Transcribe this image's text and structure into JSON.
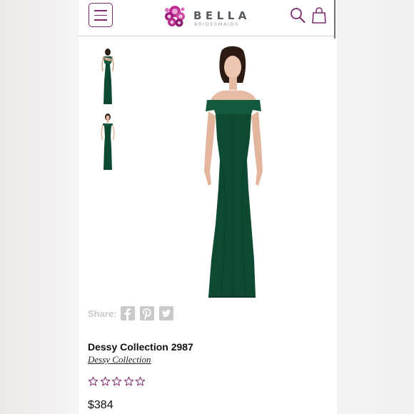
{
  "header": {
    "brand": "BELLA",
    "brand_sub": "BRIDESMAIDS",
    "menu_icon": "hamburger-menu-icon",
    "search_icon": "search-icon",
    "cart_icon": "shopping-bag-icon",
    "accent_color": "#7d2a6f",
    "logo_color": "#b31f8b"
  },
  "gallery": {
    "thumbnails": [
      {
        "view": "back"
      },
      {
        "view": "front"
      }
    ],
    "main_view": "front",
    "dress_color": "#0e4a32"
  },
  "share": {
    "label": "Share:",
    "icons": [
      "facebook-icon",
      "pinterest-icon",
      "twitter-icon"
    ]
  },
  "product": {
    "title": "Dessy Collection 2987",
    "brand": "Dessy Collection",
    "rating_stars": 5,
    "rating_value": 0,
    "price": "$384",
    "star_color": "#7d2a6f"
  }
}
